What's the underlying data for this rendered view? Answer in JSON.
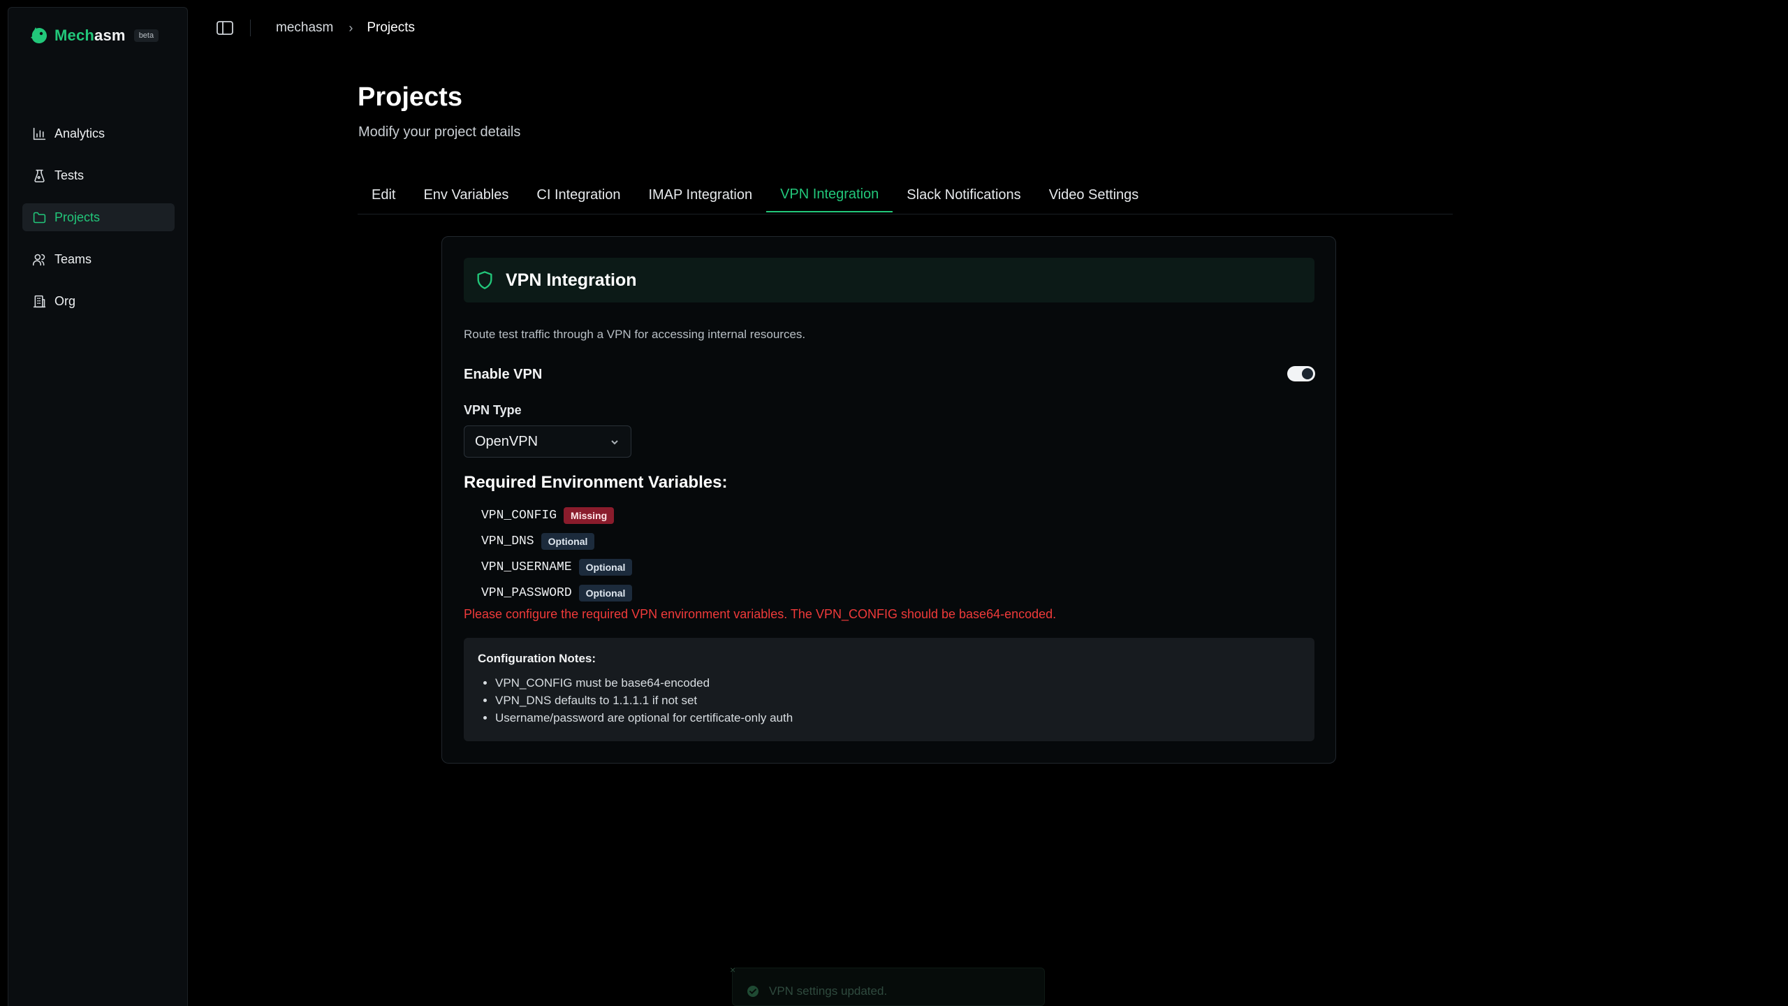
{
  "brand": {
    "name_a": "Mech",
    "name_b": "asm",
    "badge": "beta"
  },
  "sidebar": {
    "items": [
      {
        "label": "Analytics",
        "icon": "bar-chart-icon",
        "active": false
      },
      {
        "label": "Tests",
        "icon": "test-flask-icon",
        "active": false
      },
      {
        "label": "Projects",
        "icon": "folder-icon",
        "active": true
      },
      {
        "label": "Teams",
        "icon": "users-icon",
        "active": false
      },
      {
        "label": "Org",
        "icon": "building-icon",
        "active": false
      }
    ]
  },
  "breadcrumb": {
    "parent": "mechasm",
    "separator": "›",
    "current": "Projects"
  },
  "header": {
    "title": "Projects",
    "subtitle": "Modify your project details"
  },
  "tabs": [
    {
      "label": "Edit",
      "active": false
    },
    {
      "label": "Env Variables",
      "active": false
    },
    {
      "label": "CI Integration",
      "active": false
    },
    {
      "label": "IMAP Integration",
      "active": false
    },
    {
      "label": "VPN Integration",
      "active": true
    },
    {
      "label": "Slack Notifications",
      "active": false
    },
    {
      "label": "Video Settings",
      "active": false
    }
  ],
  "vpn": {
    "title": "VPN Integration",
    "description": "Route test traffic through a VPN for accessing internal resources.",
    "enable_label": "Enable VPN",
    "enabled": true,
    "type_label": "VPN Type",
    "type_value": "OpenVPN",
    "required_title": "Required Environment Variables:",
    "env_vars": [
      {
        "name": "VPN_CONFIG",
        "status": "Missing",
        "kind": "missing"
      },
      {
        "name": "VPN_DNS",
        "status": "Optional",
        "kind": "optional"
      },
      {
        "name": "VPN_USERNAME",
        "status": "Optional",
        "kind": "optional"
      },
      {
        "name": "VPN_PASSWORD",
        "status": "Optional",
        "kind": "optional"
      }
    ],
    "error": "Please configure the required VPN environment variables. The VPN_CONFIG should be base64-encoded.",
    "notes_title": "Configuration Notes:",
    "notes": [
      "VPN_CONFIG must be base64-encoded",
      "VPN_DNS defaults to 1.1.1.1 if not set",
      "Username/password are optional for certificate-only auth"
    ]
  },
  "toast": {
    "message": "VPN settings updated.",
    "close": "×"
  },
  "colors": {
    "accent": "#22c77a",
    "error": "#ef3a3a",
    "missing_badge": "#8a1c2c",
    "optional_badge": "#1c2b3c"
  }
}
